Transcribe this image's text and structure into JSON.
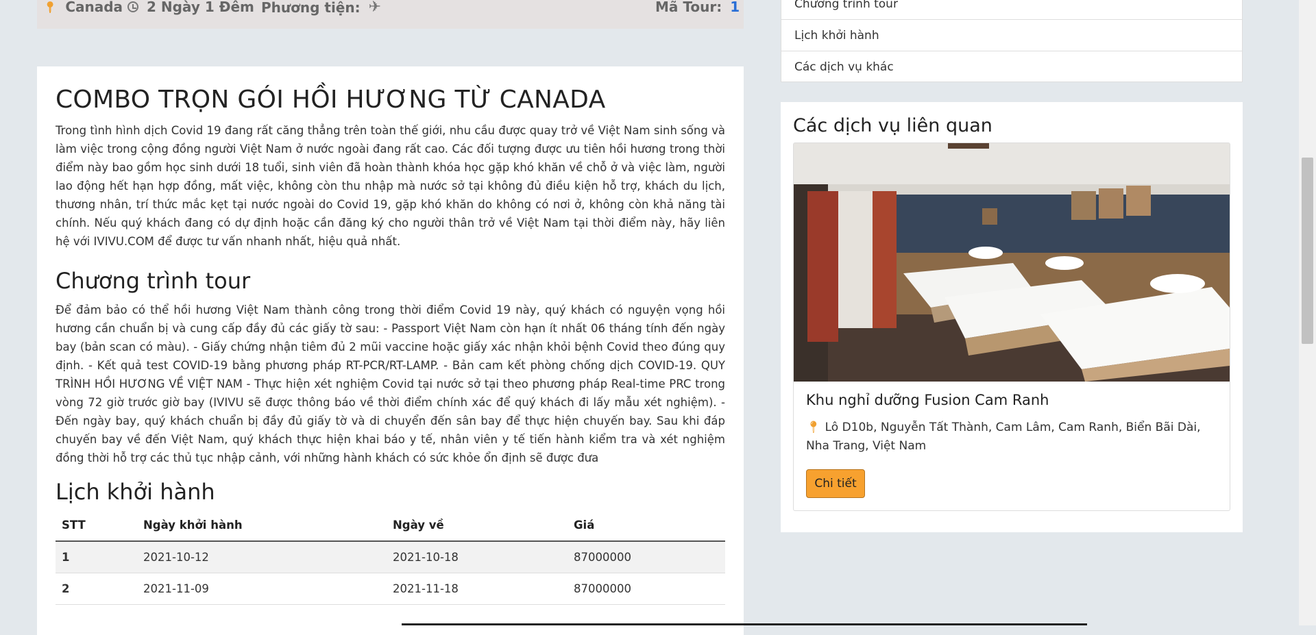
{
  "infobar": {
    "location": "Canada",
    "duration": "2 Ngày 1 Đêm",
    "transport_label": "Phương tiện:",
    "tour_code_label": "Mã Tour:",
    "tour_code": "1"
  },
  "main": {
    "title": "COMBO TRỌN GÓI HỒI HƯƠNG TỪ CANADA",
    "intro": "Trong tình hình dịch Covid 19 đang rất căng thẳng trên toàn thế giới, nhu cầu được quay trở về Việt Nam sinh sống và làm việc trong cộng đồng người Việt Nam ở nước ngoài đang rất cao. Các đối tượng được ưu tiên hồi hương trong thời điểm này bao gồm học sinh dưới 18 tuổi, sinh viên đã hoàn thành khóa học gặp khó khăn về chỗ ở và việc làm, người lao động hết hạn hợp đồng, mất việc, không còn thu nhập mà nước sở tại không đủ điều kiện hỗ trợ, khách du lịch, thương nhân, trí thức mắc kẹt tại nước ngoài do Covid 19, gặp khó khăn do không có nơi ở, không còn khả năng tài chính. Nếu quý khách đang có dự định hoặc cần đăng ký cho người thân trở về Việt Nam tại thời điểm này, hãy liên hệ với IVIVU.COM để được tư vấn nhanh nhất, hiệu quả nhất.",
    "program_heading": "Chương trình tour",
    "program_text": "Để đảm bảo có thể hồi hương Việt Nam thành công trong thời điểm Covid 19 này, quý khách có nguyện vọng hồi hương cần chuẩn bị và cung cấp đầy đủ các giấy tờ sau: - Passport Việt Nam còn hạn ít nhất 06 tháng tính đến ngày bay (bản scan có màu). - Giấy chứng nhận tiêm đủ 2 mũi vaccine hoặc giấy xác nhận khỏi bệnh Covid theo đúng quy định. - Kết quả test COVID-19 bằng phương pháp RT-PCR/RT-LAMP. - Bản cam kết phòng chống dịch COVID-19. QUY TRÌNH HỒI HƯƠNG VỀ VIỆT NAM - Thực hiện xét nghiệm Covid tại nước sở tại theo phương pháp Real-time PRC trong vòng 72 giờ trước giờ bay (IVIVU sẽ được thông báo về thời điểm chính xác để quý khách đi lấy mẫu xét nghiệm). - Đến ngày bay, quý khách chuẩn bị đầy đủ giấy tờ và di chuyển đến sân bay để thực hiện chuyến bay. Sau khi đáp chuyến bay về đến Việt Nam, quý khách thực hiện khai báo y tế, nhân viên y tế tiến hành kiểm tra và xét nghiệm đồng thời hỗ trợ các thủ tục nhập cảnh, với những hành khách có sức khỏe ổn định sẽ được đưa",
    "schedule_heading": "Lịch khởi hành",
    "schedule": {
      "headers": [
        "STT",
        "Ngày khởi hành",
        "Ngày về",
        "Giá"
      ],
      "rows": [
        [
          "1",
          "2021-10-12",
          "2021-10-18",
          "87000000"
        ],
        [
          "2",
          "2021-11-09",
          "2021-11-18",
          "87000000"
        ]
      ]
    }
  },
  "sidebar": {
    "menu": [
      "Chương trình tour",
      "Lịch khởi hành",
      "Các dịch vụ khác"
    ],
    "related_heading": "Các dịch vụ liên quan",
    "card": {
      "name": "Khu nghỉ dưỡng Fusion Cam Ranh",
      "address": "Lô D10b, Nguyễn Tất Thành, Cam Lâm, Cam Ranh, Biển Bãi Dài, Nha Trang, Việt Nam",
      "button": "Chi tiết"
    }
  }
}
